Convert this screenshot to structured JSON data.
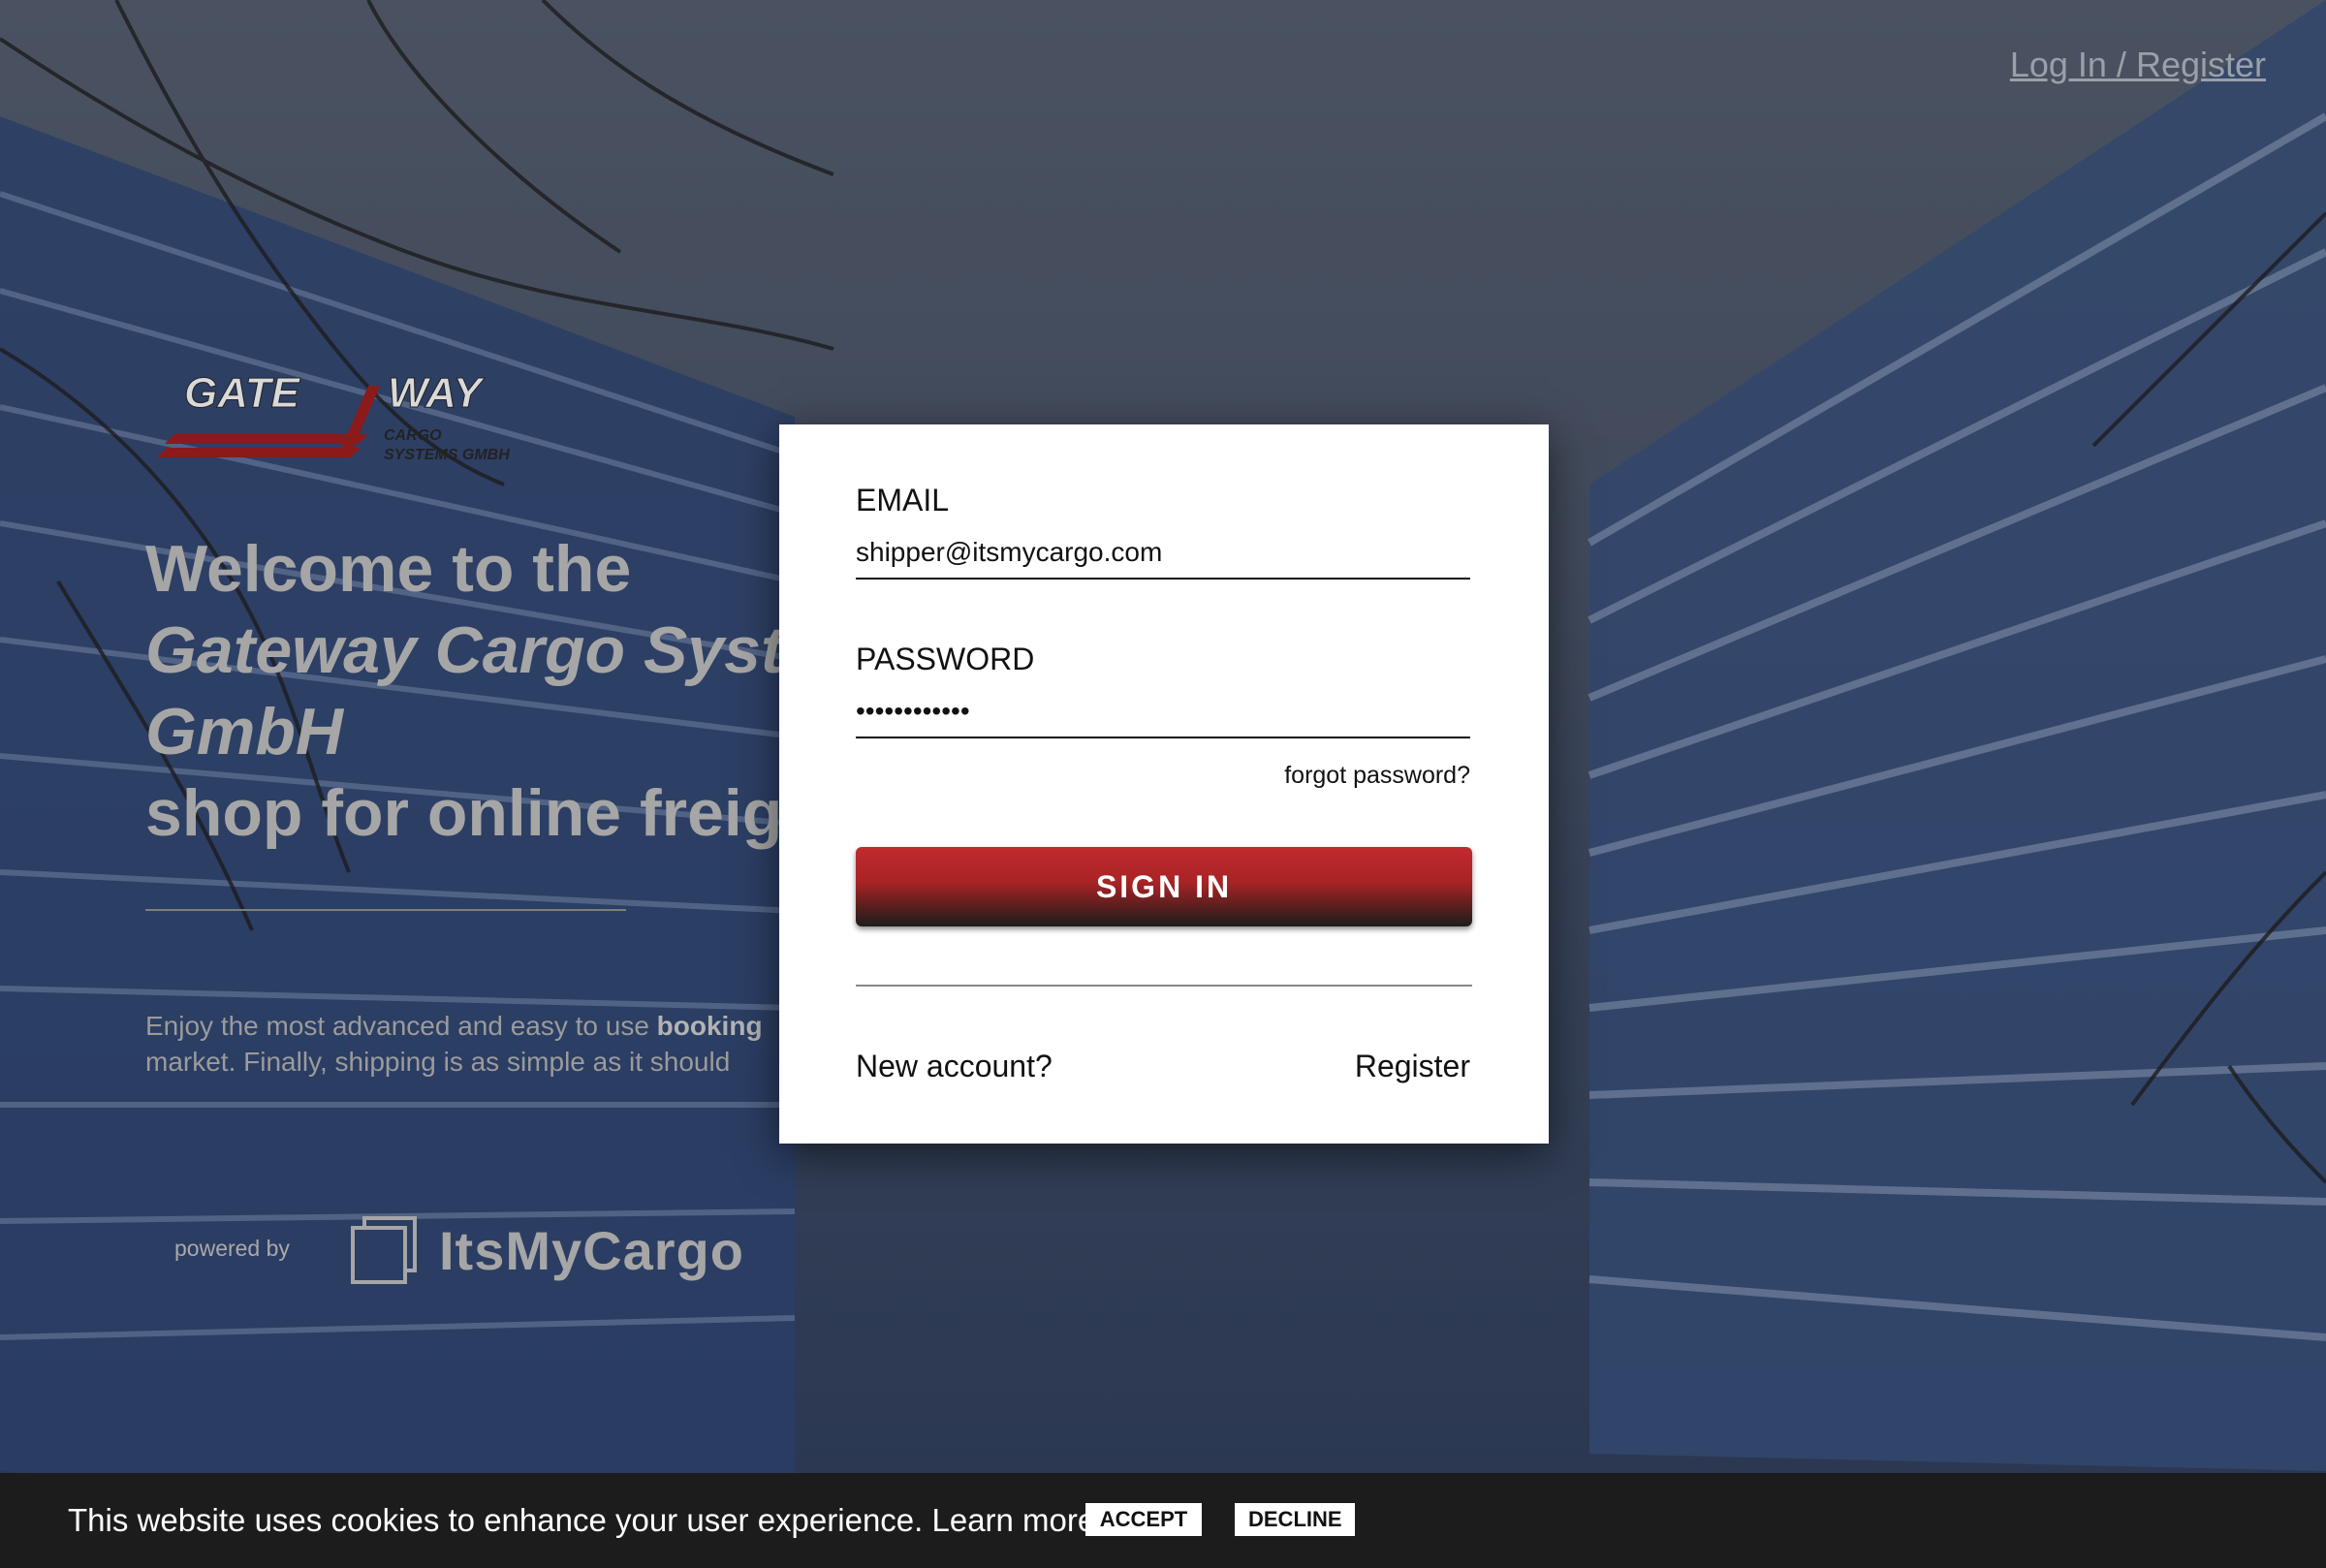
{
  "nav": {
    "login_register": "Log In / Register"
  },
  "brand": {
    "logo_word_left": "GATE",
    "logo_word_right": "WAY",
    "logo_sub1": "CARGO",
    "logo_sub2": "SYSTEMS GMBH",
    "welcome_line1": "Welcome to the",
    "welcome_line2": "Gateway Cargo Systems",
    "welcome_line3": "GmbH",
    "welcome_line4": "shop for online freight",
    "enjoy_prefix": "Enjoy the most advanced and easy to use ",
    "enjoy_bold": "booking",
    "enjoy_line2": "market. Finally, shipping is as simple as it should",
    "powered_by": "powered by",
    "imc_name": "ItsMyCargo"
  },
  "login": {
    "email_label": "EMAIL",
    "email_value": "shipper@itsmycargo.com",
    "password_label": "PASSWORD",
    "password_value": "••••••••••••",
    "forgot_label": "forgot password?",
    "signin_label": "SIGN IN",
    "new_account_label": "New account?",
    "register_label": "Register"
  },
  "cookie": {
    "message": "This website uses cookies to enhance your user experience. Learn more",
    "accept_label": "ACCEPT",
    "decline_label": "DECLINE"
  },
  "colors": {
    "accent_red": "#c22a2e",
    "cookie_bg": "#1c1c1c",
    "card_bg": "#ffffff"
  }
}
